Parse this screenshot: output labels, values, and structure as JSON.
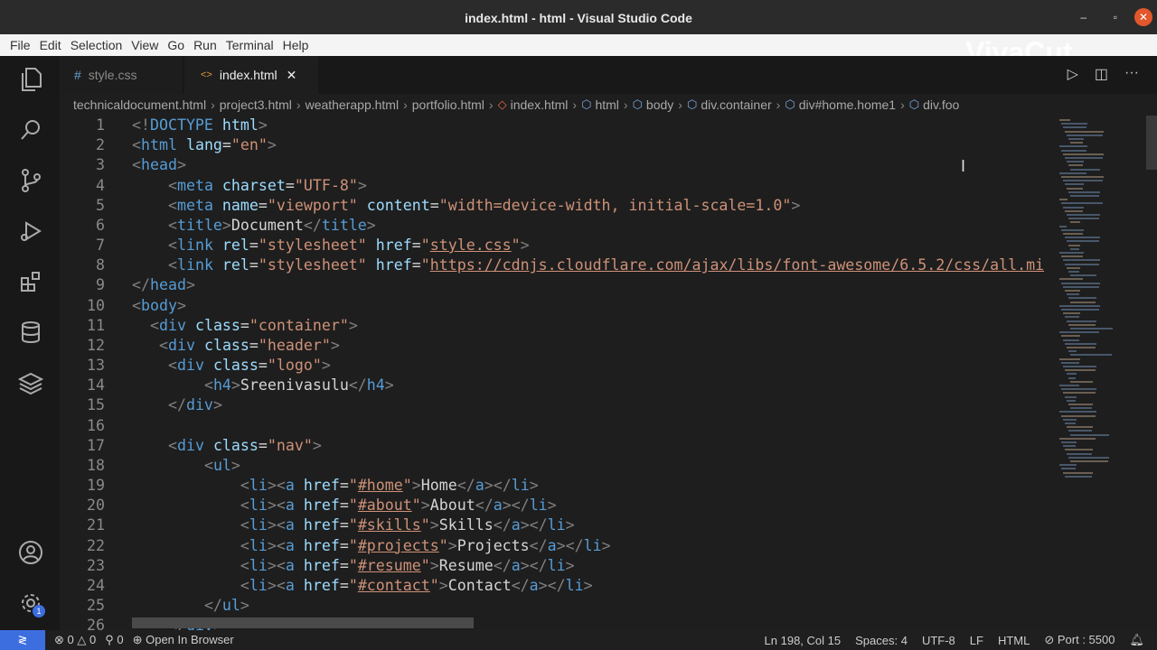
{
  "window": {
    "title": "index.html - html - Visual Studio Code",
    "minimize": "–",
    "maximize": "▫",
    "close": "✕"
  },
  "menu": [
    "File",
    "Edit",
    "Selection",
    "View",
    "Go",
    "Run",
    "Terminal",
    "Help"
  ],
  "watermark": "VivaCut",
  "tabs": [
    {
      "label": "style.css",
      "icon": "#"
    },
    {
      "label": "index.html",
      "icon": "<>",
      "close": "✕"
    }
  ],
  "breadcrumb": [
    "technicaldocument.html",
    "project3.html",
    "weatherapp.html",
    "portfolio.html",
    "index.html",
    "html",
    "body",
    "div.container",
    "div#home.home1",
    "div.foo"
  ],
  "editor": {
    "lines": [
      [
        [
          "p",
          "<!"
        ],
        [
          "t",
          "DOCTYPE"
        ],
        [
          "a",
          " html"
        ],
        [
          "p",
          ">"
        ]
      ],
      [
        [
          "p",
          "<"
        ],
        [
          "t",
          "html"
        ],
        [
          "a",
          " lang"
        ],
        [
          "x",
          "="
        ],
        [
          "s",
          "\"en\""
        ],
        [
          "p",
          ">"
        ]
      ],
      [
        [
          "p",
          "<"
        ],
        [
          "t",
          "head"
        ],
        [
          "p",
          ">"
        ]
      ],
      [
        [
          "x",
          "    "
        ],
        [
          "p",
          "<"
        ],
        [
          "t",
          "meta"
        ],
        [
          "a",
          " charset"
        ],
        [
          "x",
          "="
        ],
        [
          "s",
          "\"UTF-8\""
        ],
        [
          "p",
          ">"
        ]
      ],
      [
        [
          "x",
          "    "
        ],
        [
          "p",
          "<"
        ],
        [
          "t",
          "meta"
        ],
        [
          "a",
          " name"
        ],
        [
          "x",
          "="
        ],
        [
          "s",
          "\"viewport\""
        ],
        [
          "a",
          " content"
        ],
        [
          "x",
          "="
        ],
        [
          "s",
          "\"width=device-width, initial-scale=1.0\""
        ],
        [
          "p",
          ">"
        ]
      ],
      [
        [
          "x",
          "    "
        ],
        [
          "p",
          "<"
        ],
        [
          "t",
          "title"
        ],
        [
          "p",
          ">"
        ],
        [
          "x",
          "Document"
        ],
        [
          "p",
          "</"
        ],
        [
          "t",
          "title"
        ],
        [
          "p",
          ">"
        ]
      ],
      [
        [
          "x",
          "    "
        ],
        [
          "p",
          "<"
        ],
        [
          "t",
          "link"
        ],
        [
          "a",
          " rel"
        ],
        [
          "x",
          "="
        ],
        [
          "s",
          "\"stylesheet\""
        ],
        [
          "a",
          " href"
        ],
        [
          "x",
          "="
        ],
        [
          "s",
          "\""
        ],
        [
          "u",
          "style.css"
        ],
        [
          "s",
          "\""
        ],
        [
          "p",
          ">"
        ]
      ],
      [
        [
          "x",
          "    "
        ],
        [
          "p",
          "<"
        ],
        [
          "t",
          "link"
        ],
        [
          "a",
          " rel"
        ],
        [
          "x",
          "="
        ],
        [
          "s",
          "\"stylesheet\""
        ],
        [
          "a",
          " href"
        ],
        [
          "x",
          "="
        ],
        [
          "s",
          "\""
        ],
        [
          "u",
          "https://cdnjs.cloudflare.com/ajax/libs/font-awesome/6.5.2/css/all.mi"
        ]
      ],
      [
        [
          "p",
          "</"
        ],
        [
          "t",
          "head"
        ],
        [
          "p",
          ">"
        ]
      ],
      [
        [
          "p",
          "<"
        ],
        [
          "t",
          "body"
        ],
        [
          "p",
          ">"
        ]
      ],
      [
        [
          "x",
          "  "
        ],
        [
          "p",
          "<"
        ],
        [
          "t",
          "div"
        ],
        [
          "a",
          " class"
        ],
        [
          "x",
          "="
        ],
        [
          "s",
          "\"container\""
        ],
        [
          "p",
          ">"
        ]
      ],
      [
        [
          "x",
          "   "
        ],
        [
          "p",
          "<"
        ],
        [
          "t",
          "div"
        ],
        [
          "a",
          " class"
        ],
        [
          "x",
          "="
        ],
        [
          "s",
          "\"header\""
        ],
        [
          "p",
          ">"
        ]
      ],
      [
        [
          "x",
          "    "
        ],
        [
          "p",
          "<"
        ],
        [
          "t",
          "div"
        ],
        [
          "a",
          " class"
        ],
        [
          "x",
          "="
        ],
        [
          "s",
          "\"logo\""
        ],
        [
          "p",
          ">"
        ]
      ],
      [
        [
          "x",
          "        "
        ],
        [
          "p",
          "<"
        ],
        [
          "t",
          "h4"
        ],
        [
          "p",
          ">"
        ],
        [
          "x",
          "Sreenivasulu"
        ],
        [
          "p",
          "</"
        ],
        [
          "t",
          "h4"
        ],
        [
          "p",
          ">"
        ]
      ],
      [
        [
          "x",
          "    "
        ],
        [
          "p",
          "</"
        ],
        [
          "t",
          "div"
        ],
        [
          "p",
          ">"
        ]
      ],
      [],
      [
        [
          "x",
          "    "
        ],
        [
          "p",
          "<"
        ],
        [
          "t",
          "div"
        ],
        [
          "a",
          " class"
        ],
        [
          "x",
          "="
        ],
        [
          "s",
          "\"nav\""
        ],
        [
          "p",
          ">"
        ]
      ],
      [
        [
          "x",
          "        "
        ],
        [
          "p",
          "<"
        ],
        [
          "t",
          "ul"
        ],
        [
          "p",
          ">"
        ]
      ],
      [
        [
          "x",
          "            "
        ],
        [
          "p",
          "<"
        ],
        [
          "t",
          "li"
        ],
        [
          "p",
          "><"
        ],
        [
          "t",
          "a"
        ],
        [
          "a",
          " href"
        ],
        [
          "x",
          "="
        ],
        [
          "s",
          "\""
        ],
        [
          "u",
          "#home"
        ],
        [
          "s",
          "\""
        ],
        [
          "p",
          ">"
        ],
        [
          "x",
          "Home"
        ],
        [
          "p",
          "</"
        ],
        [
          "t",
          "a"
        ],
        [
          "p",
          "></"
        ],
        [
          "t",
          "li"
        ],
        [
          "p",
          ">"
        ]
      ],
      [
        [
          "x",
          "            "
        ],
        [
          "p",
          "<"
        ],
        [
          "t",
          "li"
        ],
        [
          "p",
          "><"
        ],
        [
          "t",
          "a"
        ],
        [
          "a",
          " href"
        ],
        [
          "x",
          "="
        ],
        [
          "s",
          "\""
        ],
        [
          "u",
          "#about"
        ],
        [
          "s",
          "\""
        ],
        [
          "p",
          ">"
        ],
        [
          "x",
          "About"
        ],
        [
          "p",
          "</"
        ],
        [
          "t",
          "a"
        ],
        [
          "p",
          "></"
        ],
        [
          "t",
          "li"
        ],
        [
          "p",
          ">"
        ]
      ],
      [
        [
          "x",
          "            "
        ],
        [
          "p",
          "<"
        ],
        [
          "t",
          "li"
        ],
        [
          "p",
          "><"
        ],
        [
          "t",
          "a"
        ],
        [
          "a",
          " href"
        ],
        [
          "x",
          "="
        ],
        [
          "s",
          "\""
        ],
        [
          "u",
          "#skills"
        ],
        [
          "s",
          "\""
        ],
        [
          "p",
          ">"
        ],
        [
          "x",
          "Skills"
        ],
        [
          "p",
          "</"
        ],
        [
          "t",
          "a"
        ],
        [
          "p",
          "></"
        ],
        [
          "t",
          "li"
        ],
        [
          "p",
          ">"
        ]
      ],
      [
        [
          "x",
          "            "
        ],
        [
          "p",
          "<"
        ],
        [
          "t",
          "li"
        ],
        [
          "p",
          "><"
        ],
        [
          "t",
          "a"
        ],
        [
          "a",
          " href"
        ],
        [
          "x",
          "="
        ],
        [
          "s",
          "\""
        ],
        [
          "u",
          "#projects"
        ],
        [
          "s",
          "\""
        ],
        [
          "p",
          ">"
        ],
        [
          "x",
          "Projects"
        ],
        [
          "p",
          "</"
        ],
        [
          "t",
          "a"
        ],
        [
          "p",
          "></"
        ],
        [
          "t",
          "li"
        ],
        [
          "p",
          ">"
        ]
      ],
      [
        [
          "x",
          "            "
        ],
        [
          "p",
          "<"
        ],
        [
          "t",
          "li"
        ],
        [
          "p",
          "><"
        ],
        [
          "t",
          "a"
        ],
        [
          "a",
          " href"
        ],
        [
          "x",
          "="
        ],
        [
          "s",
          "\""
        ],
        [
          "u",
          "#resume"
        ],
        [
          "s",
          "\""
        ],
        [
          "p",
          ">"
        ],
        [
          "x",
          "Resume"
        ],
        [
          "p",
          "</"
        ],
        [
          "t",
          "a"
        ],
        [
          "p",
          "></"
        ],
        [
          "t",
          "li"
        ],
        [
          "p",
          ">"
        ]
      ],
      [
        [
          "x",
          "            "
        ],
        [
          "p",
          "<"
        ],
        [
          "t",
          "li"
        ],
        [
          "p",
          "><"
        ],
        [
          "t",
          "a"
        ],
        [
          "a",
          " href"
        ],
        [
          "x",
          "="
        ],
        [
          "s",
          "\""
        ],
        [
          "u",
          "#contact"
        ],
        [
          "s",
          "\""
        ],
        [
          "p",
          ">"
        ],
        [
          "x",
          "Contact"
        ],
        [
          "p",
          "</"
        ],
        [
          "t",
          "a"
        ],
        [
          "p",
          "></"
        ],
        [
          "t",
          "li"
        ],
        [
          "p",
          ">"
        ]
      ],
      [
        [
          "x",
          "        "
        ],
        [
          "p",
          "</"
        ],
        [
          "t",
          "ul"
        ],
        [
          "p",
          ">"
        ]
      ],
      [
        [
          "x",
          "    "
        ],
        [
          "p",
          "</"
        ],
        [
          "t",
          "div"
        ],
        [
          "p",
          ">"
        ]
      ]
    ]
  },
  "status": {
    "errors": "0",
    "warnings": "0",
    "ports": "0",
    "open_browser": "Open In Browser",
    "position": "Ln 198, Col 15",
    "spaces": "Spaces: 4",
    "encoding": "UTF-8",
    "eol": "LF",
    "language": "HTML",
    "port": "Port : 5500",
    "notifications_badge": "1"
  }
}
